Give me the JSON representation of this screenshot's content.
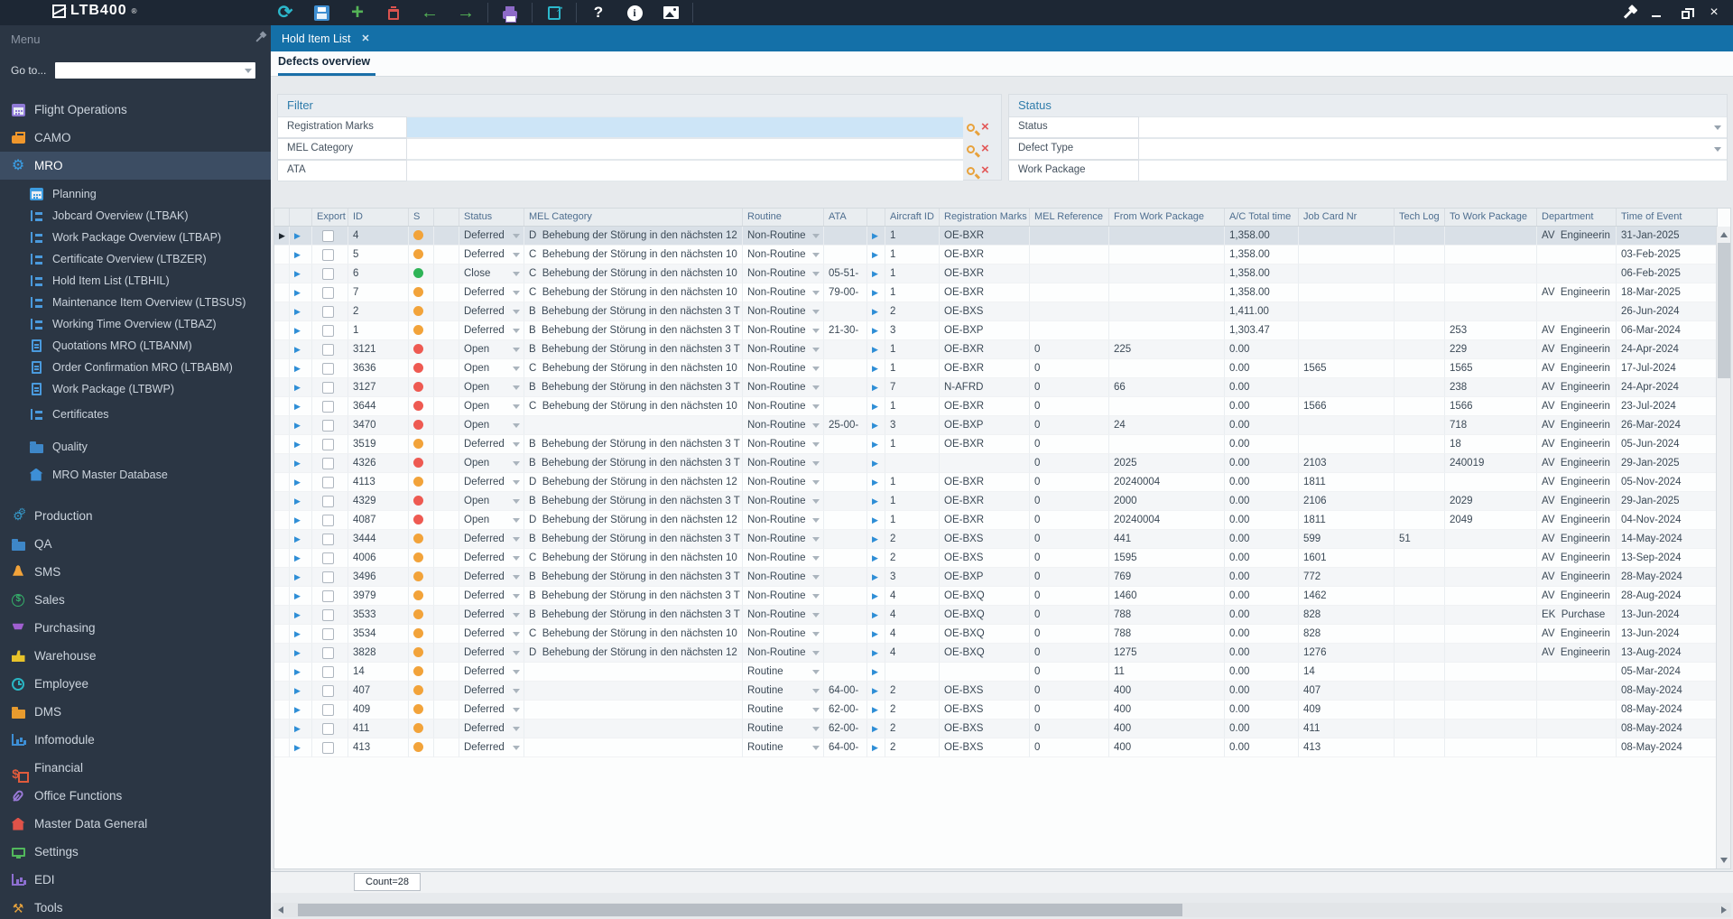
{
  "topbar": {
    "logo_text": "LTB400",
    "logo_mark": "®",
    "tools": [
      {
        "name": "refresh",
        "type": "refresh",
        "glyph": "⟳",
        "color": "#2cb8cc"
      },
      {
        "name": "save",
        "type": "save",
        "color": "#3f8fd2"
      },
      {
        "name": "add",
        "type": "plus",
        "glyph": "+",
        "color": "#55b457"
      },
      {
        "name": "delete",
        "type": "trash",
        "color": "#d9534f"
      },
      {
        "name": "back",
        "type": "arrow",
        "glyph": "←",
        "color": "#55b457"
      },
      {
        "name": "forward",
        "type": "arrow",
        "glyph": "→",
        "color": "#55b457",
        "sep_after": true
      },
      {
        "name": "print",
        "type": "printer",
        "color": "#8e6bc8",
        "sep_after": true
      },
      {
        "name": "export",
        "type": "export",
        "color": "#2cb8cc",
        "sep_after": true
      },
      {
        "name": "help",
        "type": "help",
        "glyph": "?",
        "color": "#ffffff"
      },
      {
        "name": "info",
        "type": "info",
        "glyph": "i",
        "color": "#ffffff"
      },
      {
        "name": "image",
        "type": "image",
        "color": "#ffffff",
        "sep_after": true
      }
    ],
    "window_controls": [
      "pin",
      "minimize",
      "restore",
      "close"
    ]
  },
  "sidebar": {
    "header": "Menu",
    "goto_label": "Go to...",
    "goto_value": "",
    "items": [
      {
        "label": "Flight Operations",
        "type": "cal",
        "color": "#8f7ad6",
        "level": 0
      },
      {
        "label": "CAMO",
        "type": "case",
        "color": "#f0972c",
        "level": 0
      },
      {
        "label": "MRO",
        "type": "gear",
        "color": "#3aa0e8",
        "level": 0,
        "selected": true
      },
      {
        "label": "Planning",
        "type": "cal",
        "color": "#3d9ce0",
        "level": 1,
        "gap": "gap4"
      },
      {
        "label": "Jobcard Overview (LTBAK)",
        "type": "tree",
        "color": "#4a9add",
        "level": 1
      },
      {
        "label": "Work Package Overview (LTBAP)",
        "type": "tree",
        "color": "#4a9add",
        "level": 1
      },
      {
        "label": "Certificate Overview (LTBZER)",
        "type": "tree",
        "color": "#4a9add",
        "level": 1
      },
      {
        "label": "Hold Item List (LTBHIL)",
        "type": "tree",
        "color": "#4a9add",
        "level": 1
      },
      {
        "label": "Maintenance Item Overview (LTBSUS)",
        "type": "tree",
        "color": "#4a9add",
        "level": 1
      },
      {
        "label": "Working Time Overview (LTBAZ)",
        "type": "tree",
        "color": "#4a9add",
        "level": 1
      },
      {
        "label": "Quotations MRO (LTBANM)",
        "type": "doc",
        "color": "#4a9add",
        "level": 1
      },
      {
        "label": "Order Confirmation MRO (LTBABM)",
        "type": "doc",
        "color": "#4a9add",
        "level": 1
      },
      {
        "label": "Work Package (LTBWP)",
        "type": "doc",
        "color": "#4a9add",
        "level": 1
      },
      {
        "label": "Certificates",
        "type": "tree",
        "color": "#4a9add",
        "level": 1,
        "gap": "gap4"
      },
      {
        "label": "Quality",
        "type": "folder",
        "color": "#3e87c8",
        "level": 1,
        "tall": true,
        "gap": "gap8"
      },
      {
        "label": "MRO Master Database",
        "type": "home",
        "color": "#3d8fd6",
        "level": 1,
        "tall": true
      },
      {
        "label": "Production",
        "type": "gears",
        "color": "#3698c8",
        "level": 0,
        "gap": "gap15"
      },
      {
        "label": "QA",
        "type": "folder",
        "color": "#3e87c8",
        "level": 0
      },
      {
        "label": "SMS",
        "type": "bell",
        "color": "#f2a33a",
        "level": 0
      },
      {
        "label": "Sales",
        "type": "dollar",
        "color": "#35b06a",
        "level": 0
      },
      {
        "label": "Purchasing",
        "type": "cart",
        "color": "#a05fd0",
        "level": 0
      },
      {
        "label": "Warehouse",
        "type": "fork",
        "color": "#e8c32a",
        "level": 0
      },
      {
        "label": "Employee",
        "type": "clock",
        "color": "#2ab6c4",
        "level": 0
      },
      {
        "label": "DMS",
        "type": "folder",
        "color": "#e89b2e",
        "level": 0
      },
      {
        "label": "Infomodule",
        "type": "chart",
        "color": "#3d8fd6",
        "level": 0
      },
      {
        "label": "Financial",
        "type": "money",
        "color": "#e05b3c",
        "level": 0
      },
      {
        "label": "Office Functions",
        "type": "clip",
        "color": "#9a7ad8",
        "level": 0
      },
      {
        "label": "Master Data General",
        "type": "home",
        "color": "#e05349",
        "level": 0
      },
      {
        "label": "Settings",
        "type": "monitor",
        "color": "#52b85c",
        "level": 0
      },
      {
        "label": "EDI",
        "type": "chart",
        "color": "#8d6fd1",
        "level": 0
      },
      {
        "label": "Tools",
        "type": "tools",
        "color": "#e8a33d",
        "level": 0
      }
    ]
  },
  "tab": {
    "label": "Hold Item List",
    "close_glyph": "✕"
  },
  "subtab": {
    "label": "Defects overview"
  },
  "filter": {
    "title": "Filter",
    "rows": [
      {
        "label": "Registration Marks",
        "value": "",
        "highlighted": true
      },
      {
        "label": "MEL Category",
        "value": ""
      },
      {
        "label": "ATA",
        "value": ""
      }
    ]
  },
  "status_panel": {
    "title": "Status",
    "rows": [
      {
        "label": "Status",
        "value": "",
        "control": "dropdown"
      },
      {
        "label": "Defect Type",
        "value": "",
        "control": "dropdown"
      },
      {
        "label": "Work Package",
        "value": "",
        "control": "search"
      }
    ]
  },
  "grid": {
    "columns": [
      "",
      "",
      "Export",
      "ID",
      "S",
      "",
      "Status",
      "MEL Category",
      "Routine",
      "ATA",
      "",
      "Aircraft ID",
      "Registration Marks",
      "MEL Reference",
      "From Work Package",
      "A/C Total time",
      "Job Card Nr",
      "Tech Log",
      "To Work Package",
      "Department",
      "Time of Event"
    ],
    "status_colors": {
      "orange": "#f2a33a",
      "red": "#ee5a52",
      "green": "#2fb457"
    },
    "rows": [
      {
        "id": "4",
        "s": "orange",
        "status": "Deferred",
        "mel": "D  Behebung der Störung in den nächsten 12",
        "routine": "Non-Routine",
        "ata": "",
        "aircraft": "1",
        "reg": "OE-BXR",
        "mel_ref": "",
        "from_wp": "",
        "ac_total": "1,358.00",
        "job_card": "",
        "tech_log": "",
        "to_wp": "",
        "dept": "AV  Engineerin",
        "time": "31-Jan-2025",
        "selected": true
      },
      {
        "id": "5",
        "s": "orange",
        "status": "Deferred",
        "mel": "C  Behebung der Störung in den nächsten 10",
        "routine": "Non-Routine",
        "ata": "",
        "aircraft": "1",
        "reg": "OE-BXR",
        "mel_ref": "",
        "from_wp": "",
        "ac_total": "1,358.00",
        "job_card": "",
        "tech_log": "",
        "to_wp": "",
        "dept": "",
        "time": "03-Feb-2025"
      },
      {
        "id": "6",
        "s": "green",
        "status": "Close",
        "mel": "C  Behebung der Störung in den nächsten 10",
        "routine": "Non-Routine",
        "ata": "05-51-",
        "aircraft": "1",
        "reg": "OE-BXR",
        "mel_ref": "",
        "from_wp": "",
        "ac_total": "1,358.00",
        "job_card": "",
        "tech_log": "",
        "to_wp": "",
        "dept": "",
        "time": "06-Feb-2025"
      },
      {
        "id": "7",
        "s": "orange",
        "status": "Deferred",
        "mel": "C  Behebung der Störung in den nächsten 10",
        "routine": "Non-Routine",
        "ata": "79-00-",
        "aircraft": "1",
        "reg": "OE-BXR",
        "mel_ref": "",
        "from_wp": "",
        "ac_total": "1,358.00",
        "job_card": "",
        "tech_log": "",
        "to_wp": "",
        "dept": "AV  Engineerin",
        "time": "18-Mar-2025"
      },
      {
        "id": "2",
        "s": "orange",
        "status": "Deferred",
        "mel": "B  Behebung der Störung in den nächsten 3 T",
        "routine": "Non-Routine",
        "ata": "",
        "aircraft": "2",
        "reg": "OE-BXS",
        "mel_ref": "",
        "from_wp": "",
        "ac_total": "1,411.00",
        "job_card": "",
        "tech_log": "",
        "to_wp": "",
        "dept": "",
        "time": "26-Jun-2024"
      },
      {
        "id": "1",
        "s": "orange",
        "status": "Deferred",
        "mel": "B  Behebung der Störung in den nächsten 3 T",
        "routine": "Non-Routine",
        "ata": "21-30-",
        "aircraft": "3",
        "reg": "OE-BXP",
        "mel_ref": "",
        "from_wp": "",
        "ac_total": "1,303.47",
        "job_card": "",
        "tech_log": "",
        "to_wp": "253",
        "dept": "AV  Engineerin",
        "time": "06-Mar-2024"
      },
      {
        "id": "3121",
        "s": "red",
        "status": "Open",
        "mel": "B  Behebung der Störung in den nächsten 3 T",
        "routine": "Non-Routine",
        "ata": "",
        "aircraft": "1",
        "reg": "OE-BXR",
        "mel_ref": "0",
        "from_wp": "225",
        "ac_total": "0.00",
        "job_card": "",
        "tech_log": "",
        "to_wp": "229",
        "dept": "AV  Engineerin",
        "time": "24-Apr-2024"
      },
      {
        "id": "3636",
        "s": "red",
        "status": "Open",
        "mel": "C  Behebung der Störung in den nächsten 10",
        "routine": "Non-Routine",
        "ata": "",
        "aircraft": "1",
        "reg": "OE-BXR",
        "mel_ref": "0",
        "from_wp": "",
        "ac_total": "0.00",
        "job_card": "1565",
        "tech_log": "",
        "to_wp": "1565",
        "dept": "AV  Engineerin",
        "time": "17-Jul-2024"
      },
      {
        "id": "3127",
        "s": "red",
        "status": "Open",
        "mel": "B  Behebung der Störung in den nächsten 3 T",
        "routine": "Non-Routine",
        "ata": "",
        "aircraft": "7",
        "reg": "N-AFRD",
        "mel_ref": "0",
        "from_wp": "66",
        "ac_total": "0.00",
        "job_card": "",
        "tech_log": "",
        "to_wp": "238",
        "dept": "AV  Engineerin",
        "time": "24-Apr-2024"
      },
      {
        "id": "3644",
        "s": "red",
        "status": "Open",
        "mel": "C  Behebung der Störung in den nächsten 10",
        "routine": "Non-Routine",
        "ata": "",
        "aircraft": "1",
        "reg": "OE-BXR",
        "mel_ref": "0",
        "from_wp": "",
        "ac_total": "0.00",
        "job_card": "1566",
        "tech_log": "",
        "to_wp": "1566",
        "dept": "AV  Engineerin",
        "time": "23-Jul-2024"
      },
      {
        "id": "3470",
        "s": "red",
        "status": "Open",
        "mel": "",
        "routine": "Non-Routine",
        "ata": "25-00-",
        "aircraft": "3",
        "reg": "OE-BXP",
        "mel_ref": "0",
        "from_wp": "24",
        "ac_total": "0.00",
        "job_card": "",
        "tech_log": "",
        "to_wp": "718",
        "dept": "AV  Engineerin",
        "time": "26-Mar-2024"
      },
      {
        "id": "3519",
        "s": "orange",
        "status": "Deferred",
        "mel": "B  Behebung der Störung in den nächsten 3 T",
        "routine": "Non-Routine",
        "ata": "",
        "aircraft": "1",
        "reg": "OE-BXR",
        "mel_ref": "0",
        "from_wp": "",
        "ac_total": "0.00",
        "job_card": "",
        "tech_log": "",
        "to_wp": "18",
        "dept": "AV  Engineerin",
        "time": "05-Jun-2024"
      },
      {
        "id": "4326",
        "s": "red",
        "status": "Open",
        "mel": "B  Behebung der Störung in den nächsten 3 T",
        "routine": "Non-Routine",
        "ata": "",
        "aircraft": "",
        "reg": "",
        "mel_ref": "0",
        "from_wp": "2025",
        "ac_total": "0.00",
        "job_card": "2103",
        "tech_log": "",
        "to_wp": "240019",
        "dept": "AV  Engineerin",
        "time": "29-Jan-2025"
      },
      {
        "id": "4113",
        "s": "orange",
        "status": "Deferred",
        "mel": "D  Behebung der Störung in den nächsten 12",
        "routine": "Non-Routine",
        "ata": "",
        "aircraft": "1",
        "reg": "OE-BXR",
        "mel_ref": "0",
        "from_wp": "20240004",
        "ac_total": "0.00",
        "job_card": "1811",
        "tech_log": "",
        "to_wp": "",
        "dept": "AV  Engineerin",
        "time": "05-Nov-2024"
      },
      {
        "id": "4329",
        "s": "red",
        "status": "Open",
        "mel": "B  Behebung der Störung in den nächsten 3 T",
        "routine": "Non-Routine",
        "ata": "",
        "aircraft": "1",
        "reg": "OE-BXR",
        "mel_ref": "0",
        "from_wp": "2000",
        "ac_total": "0.00",
        "job_card": "2106",
        "tech_log": "",
        "to_wp": "2029",
        "dept": "AV  Engineerin",
        "time": "29-Jan-2025"
      },
      {
        "id": "4087",
        "s": "red",
        "status": "Open",
        "mel": "D  Behebung der Störung in den nächsten 12",
        "routine": "Non-Routine",
        "ata": "",
        "aircraft": "1",
        "reg": "OE-BXR",
        "mel_ref": "0",
        "from_wp": "20240004",
        "ac_total": "0.00",
        "job_card": "1811",
        "tech_log": "",
        "to_wp": "2049",
        "dept": "AV  Engineerin",
        "time": "04-Nov-2024"
      },
      {
        "id": "3444",
        "s": "orange",
        "status": "Deferred",
        "mel": "B  Behebung der Störung in den nächsten 3 T",
        "routine": "Non-Routine",
        "ata": "",
        "aircraft": "2",
        "reg": "OE-BXS",
        "mel_ref": "0",
        "from_wp": "441",
        "ac_total": "0.00",
        "job_card": "599",
        "tech_log": "51",
        "to_wp": "",
        "dept": "AV  Engineerin",
        "time": "14-May-2024"
      },
      {
        "id": "4006",
        "s": "orange",
        "status": "Deferred",
        "mel": "C  Behebung der Störung in den nächsten 10",
        "routine": "Non-Routine",
        "ata": "",
        "aircraft": "2",
        "reg": "OE-BXS",
        "mel_ref": "0",
        "from_wp": "1595",
        "ac_total": "0.00",
        "job_card": "1601",
        "tech_log": "",
        "to_wp": "",
        "dept": "AV  Engineerin",
        "time": "13-Sep-2024"
      },
      {
        "id": "3496",
        "s": "orange",
        "status": "Deferred",
        "mel": "B  Behebung der Störung in den nächsten 3 T",
        "routine": "Non-Routine",
        "ata": "",
        "aircraft": "3",
        "reg": "OE-BXP",
        "mel_ref": "0",
        "from_wp": "769",
        "ac_total": "0.00",
        "job_card": "772",
        "tech_log": "",
        "to_wp": "",
        "dept": "AV  Engineerin",
        "time": "28-May-2024"
      },
      {
        "id": "3979",
        "s": "orange",
        "status": "Deferred",
        "mel": "B  Behebung der Störung in den nächsten 3 T",
        "routine": "Non-Routine",
        "ata": "",
        "aircraft": "4",
        "reg": "OE-BXQ",
        "mel_ref": "0",
        "from_wp": "1460",
        "ac_total": "0.00",
        "job_card": "1462",
        "tech_log": "",
        "to_wp": "",
        "dept": "AV  Engineerin",
        "time": "28-Aug-2024"
      },
      {
        "id": "3533",
        "s": "orange",
        "status": "Deferred",
        "mel": "B  Behebung der Störung in den nächsten 3 T",
        "routine": "Non-Routine",
        "ata": "",
        "aircraft": "4",
        "reg": "OE-BXQ",
        "mel_ref": "0",
        "from_wp": "788",
        "ac_total": "0.00",
        "job_card": "828",
        "tech_log": "",
        "to_wp": "",
        "dept": "EK  Purchase",
        "time": "13-Jun-2024"
      },
      {
        "id": "3534",
        "s": "orange",
        "status": "Deferred",
        "mel": "C  Behebung der Störung in den nächsten 10",
        "routine": "Non-Routine",
        "ata": "",
        "aircraft": "4",
        "reg": "OE-BXQ",
        "mel_ref": "0",
        "from_wp": "788",
        "ac_total": "0.00",
        "job_card": "828",
        "tech_log": "",
        "to_wp": "",
        "dept": "AV  Engineerin",
        "time": "13-Jun-2024"
      },
      {
        "id": "3828",
        "s": "orange",
        "status": "Deferred",
        "mel": "D  Behebung der Störung in den nächsten 12",
        "routine": "Non-Routine",
        "ata": "",
        "aircraft": "4",
        "reg": "OE-BXQ",
        "mel_ref": "0",
        "from_wp": "1275",
        "ac_total": "0.00",
        "job_card": "1276",
        "tech_log": "",
        "to_wp": "",
        "dept": "AV  Engineerin",
        "time": "13-Aug-2024"
      },
      {
        "id": "14",
        "s": "orange",
        "status": "Deferred",
        "mel": "",
        "routine": "Routine",
        "ata": "",
        "aircraft": "",
        "reg": "",
        "mel_ref": "0",
        "from_wp": "11",
        "ac_total": "0.00",
        "job_card": "14",
        "tech_log": "",
        "to_wp": "",
        "dept": "",
        "time": "05-Mar-2024"
      },
      {
        "id": "407",
        "s": "orange",
        "status": "Deferred",
        "mel": "",
        "routine": "Routine",
        "ata": "64-00-",
        "aircraft": "2",
        "reg": "OE-BXS",
        "mel_ref": "0",
        "from_wp": "400",
        "ac_total": "0.00",
        "job_card": "407",
        "tech_log": "",
        "to_wp": "",
        "dept": "",
        "time": "08-May-2024"
      },
      {
        "id": "409",
        "s": "orange",
        "status": "Deferred",
        "mel": "",
        "routine": "Routine",
        "ata": "62-00-",
        "aircraft": "2",
        "reg": "OE-BXS",
        "mel_ref": "0",
        "from_wp": "400",
        "ac_total": "0.00",
        "job_card": "409",
        "tech_log": "",
        "to_wp": "",
        "dept": "",
        "time": "08-May-2024"
      },
      {
        "id": "411",
        "s": "orange",
        "status": "Deferred",
        "mel": "",
        "routine": "Routine",
        "ata": "62-00-",
        "aircraft": "2",
        "reg": "OE-BXS",
        "mel_ref": "0",
        "from_wp": "400",
        "ac_total": "0.00",
        "job_card": "411",
        "tech_log": "",
        "to_wp": "",
        "dept": "",
        "time": "08-May-2024"
      },
      {
        "id": "413",
        "s": "orange",
        "status": "Deferred",
        "mel": "",
        "routine": "Routine",
        "ata": "64-00-",
        "aircraft": "2",
        "reg": "OE-BXS",
        "mel_ref": "0",
        "from_wp": "400",
        "ac_total": "0.00",
        "job_card": "413",
        "tech_log": "",
        "to_wp": "",
        "dept": "",
        "time": "08-May-2024"
      }
    ]
  },
  "status_bar": {
    "count": "Count=28"
  }
}
